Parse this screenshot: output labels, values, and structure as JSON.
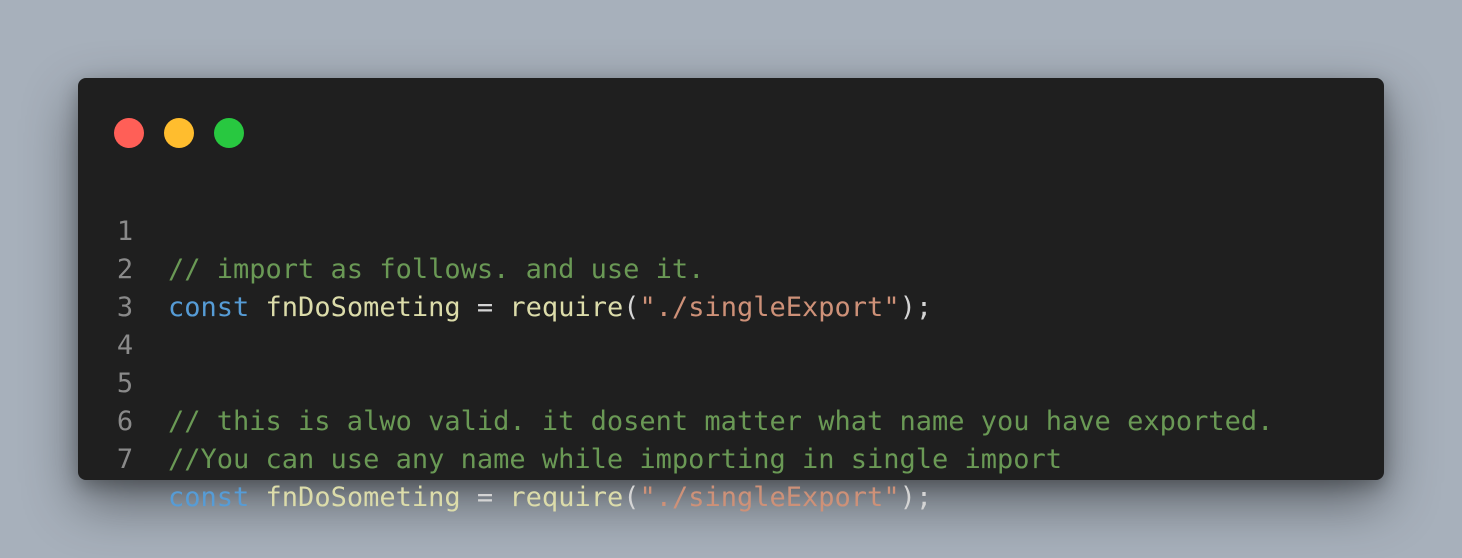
{
  "window": {
    "traffic_lights": [
      {
        "name": "close",
        "color": "#ff5f57"
      },
      {
        "name": "minimize",
        "color": "#ffbd2e"
      },
      {
        "name": "maximize",
        "color": "#28c840"
      }
    ]
  },
  "syntax_colors": {
    "comment": "#6a9955",
    "keyword": "#569cd6",
    "identifier": "#dcdcaa",
    "string": "#ce9178",
    "punctuation": "#d4d4d4",
    "line_number": "#8a8a8a",
    "background": "#1f1f1f"
  },
  "code": {
    "lines": [
      {
        "number": "1",
        "comment": "// import as follows. and use it."
      },
      {
        "number": "2",
        "keyword": "const",
        "name": "fnDoSometing",
        "op": "=",
        "func": "require",
        "open": "(",
        "string": "\"./singleExport\"",
        "close": ");"
      },
      {
        "number": "3"
      },
      {
        "number": "4"
      },
      {
        "number": "5",
        "comment": "// this is alwo valid. it dosent matter what name you have exported."
      },
      {
        "number": "6",
        "comment": "//You can use any name while importing in single import"
      },
      {
        "number": "7",
        "keyword": "const",
        "name": "fnDoSometing",
        "op": "=",
        "func": "require",
        "open": "(",
        "string": "\"./singleExport\"",
        "close": ");"
      }
    ]
  }
}
